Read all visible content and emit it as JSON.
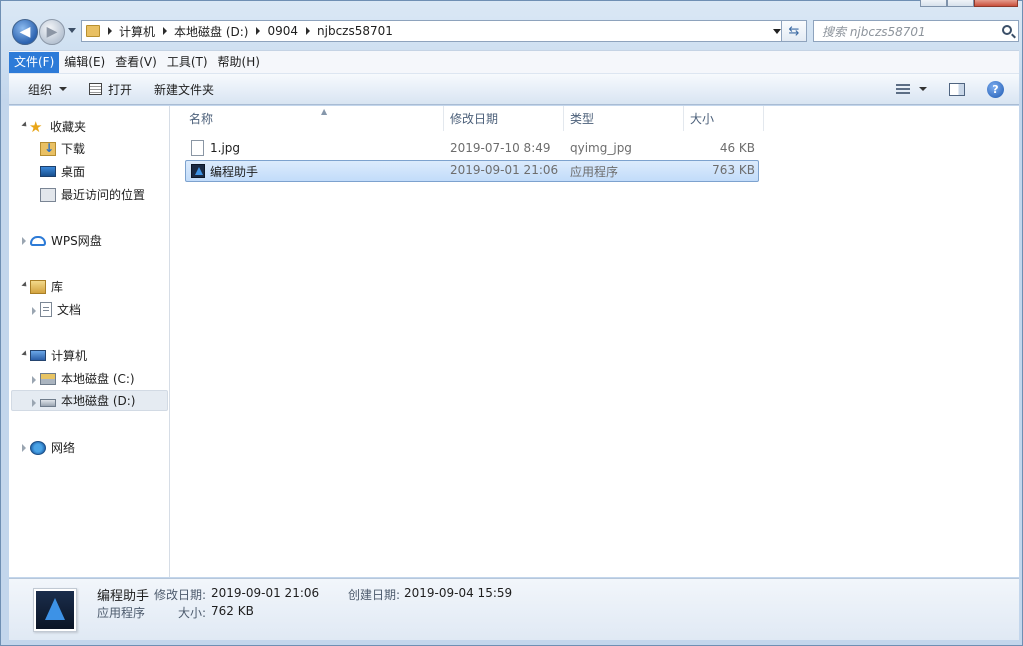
{
  "address_bar": {
    "crumbs": [
      "计算机",
      "本地磁盘 (D:)",
      "0904",
      "njbczs58701"
    ]
  },
  "search": {
    "placeholder": "搜索 njbczs58701"
  },
  "menu": {
    "items": [
      {
        "label": "文件(F)",
        "active": true
      },
      {
        "label": "编辑(E)"
      },
      {
        "label": "查看(V)"
      },
      {
        "label": "工具(T)"
      },
      {
        "label": "帮助(H)"
      }
    ]
  },
  "toolbar": {
    "organize": "组织",
    "open": "打开",
    "new_folder": "新建文件夹"
  },
  "nav": {
    "favorites": "收藏夹",
    "downloads": "下载",
    "desktop": "桌面",
    "recent": "最近访问的位置",
    "wps": "WPS网盘",
    "libraries": "库",
    "documents": "文档",
    "computer": "计算机",
    "drive_c": "本地磁盘 (C:)",
    "drive_d": "本地磁盘 (D:)",
    "network": "网络"
  },
  "columns": {
    "name": "名称",
    "modified": "修改日期",
    "type": "类型",
    "size": "大小"
  },
  "files": [
    {
      "name": "1.jpg",
      "modified": "2019-07-10 8:49",
      "type": "qyimg_jpg",
      "size": "46 KB"
    },
    {
      "name": "编程助手",
      "modified": "2019-09-01 21:06",
      "type": "应用程序",
      "size": "763 KB",
      "selected": true
    }
  ],
  "details": {
    "name": "编程助手",
    "type": "应用程序",
    "modified_label": "修改日期:",
    "modified_value": "2019-09-01 21:06",
    "created_label": "创建日期:",
    "created_value": "2019-09-04 15:59",
    "size_label": "大小:",
    "size_value": "762 KB"
  }
}
